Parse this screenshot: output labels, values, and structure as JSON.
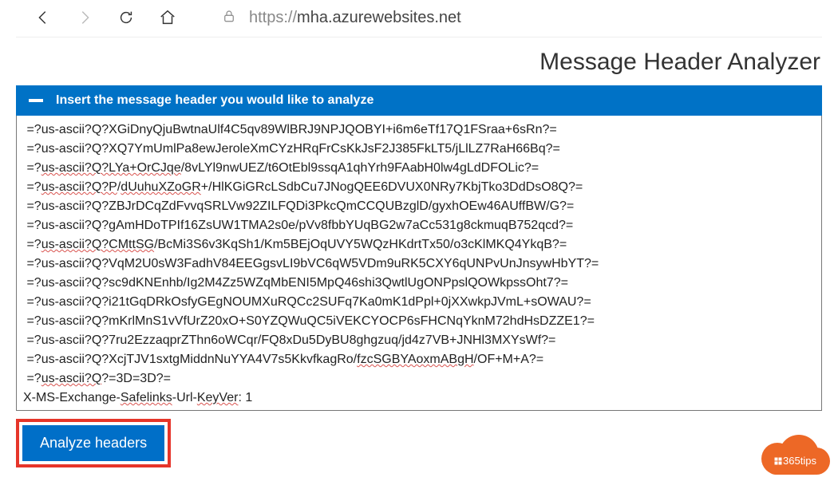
{
  "browser": {
    "url_prefix": "https://",
    "url_domain": "mha.azurewebsites.net"
  },
  "page": {
    "title": "Message Header Analyzer"
  },
  "panel": {
    "header_label": "Insert the message header you would like to analyze",
    "lines": [
      {
        "pre": " =?us-ascii?Q?XGiDnyQjuBwtnaUlf4C5qv89WlBRJ9NPJQOBYI+i6m6eTf17Q1FSraa+6sRn?=",
        "sq": []
      },
      {
        "pre": " =?us-ascii?Q?XQ7YmUmlPa8ewJeroleXmCYzHRqFrCsKkJsF2J385FkLT5/jLlLZ7RaH66Bq?=",
        "sq": []
      },
      {
        "seg": [
          " =?",
          "us-ascii?Q?LYa+OrCJqe",
          "/8vLYl9nwUEZ/t6OtEbl9ssqA1qhYrh9FAabH0lw4gLdDFOLic?="
        ]
      },
      {
        "seg": [
          " =?",
          "us-ascii?Q?P",
          "/",
          "dUuhuXZoGR",
          "+/HlKGiGRcLSdbCu7JNogQEE6DVUX0NRy7KbjTko3DdDsO8Q?="
        ]
      },
      {
        "pre": " =?us-ascii?Q?ZBJrDCqZdFvvqSRLVw92ZILFQDi3PkcQmCCQUBzglD/gyxhOEw46AUffBW/G?=",
        "sq": []
      },
      {
        "pre": " =?us-ascii?Q?gAmHDoTPIf16ZsUW1TMA2s0e/pVv8fbbYUqBG2w7aCc531g8ckmuqB752qcd?=",
        "sq": []
      },
      {
        "seg": [
          " =?",
          "us-ascii?Q?CMttSG",
          "/BcMi3S6v3KqSh1/Km5BEjOqUVY5WQzHKdrtTx50/o3cKlMKQ4YkqB?="
        ]
      },
      {
        "pre": " =?us-ascii?Q?VqM2U0sW3FadhV84EEGgsvLI9bVC6qW5VDm9uRK5CXY6qUNPvUnJnsywHbYT?=",
        "sq": []
      },
      {
        "pre": " =?us-ascii?Q?sc9dKNEnhb/Ig2M4Zz5WZqMbENI5MpQ46shi3QwtlUgONPpslQOWkpssOht7?=",
        "sq": []
      },
      {
        "pre": " =?us-ascii?Q?i21tGqDRkOsfyGEgNOUMXuRQCc2SUFq7Ka0mK1dPpl+0jXXwkpJVmL+sOWAU?=",
        "sq": []
      },
      {
        "pre": " =?us-ascii?Q?mKrlMnS1vVfUrZ20xO+S0YZQWuQC5iVEKCYOCP6sFHCNqYknM72hdHsDZZE1?=",
        "sq": []
      },
      {
        "pre": " =?us-ascii?Q?7ru2EzzaqprZThn6oWCqr/FQ8xDu5DyBU8ghgzuq/jd4z7VB+JNHl3MXYsWf?=",
        "sq": []
      },
      {
        "seg": [
          " =?us-ascii?Q?XcjTJV1sxtgMiddnNuYYA4V7s5KkvfkagRo/",
          "fzcSGBYAoxmABgH",
          "/OF+M+A?="
        ]
      },
      {
        "seg": [
          " =?",
          "us-ascii?Q",
          "?=3D=3D?="
        ]
      },
      {
        "seg": [
          "X-MS-Exchange-",
          "Safelinks",
          "-Url-",
          "KeyVer",
          ": 1"
        ]
      }
    ]
  },
  "actions": {
    "analyze_label": "Analyze headers"
  },
  "badge": {
    "text": "365tips"
  }
}
